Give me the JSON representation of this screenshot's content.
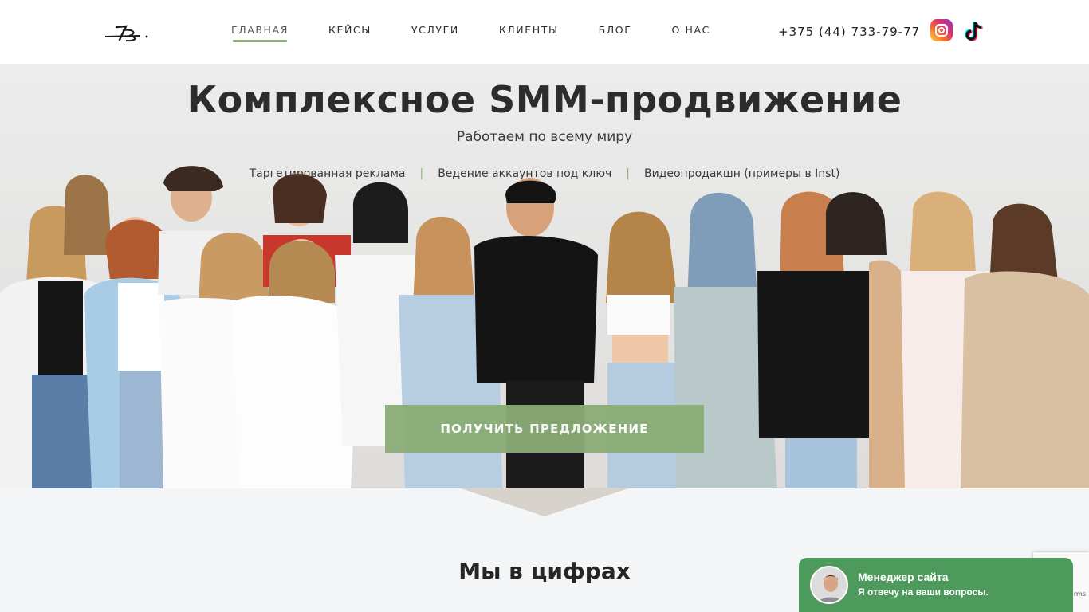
{
  "header": {
    "nav": [
      "ГЛАВНАЯ",
      "КЕЙСЫ",
      "УСЛУГИ",
      "КЛИЕНТЫ",
      "БЛОГ",
      "О НАС"
    ],
    "active_index": 0,
    "phone": "+375 (44) 733-79-77",
    "social_icons": [
      "instagram-icon",
      "tiktok-icon"
    ]
  },
  "hero": {
    "title": "Комплексное SMM-продвижение",
    "subtitle": "Работаем по всему миру",
    "services": [
      "Таргетированная реклама",
      "Ведение аккаунтов под ключ",
      "Видеопродакшн (примеры в Inst)"
    ],
    "cta": "ПОЛУЧИТЬ ПРЕДЛОЖЕНИЕ"
  },
  "stats": {
    "title": "Мы в цифрах"
  },
  "chat": {
    "name": "Менеджер сайта",
    "message": "Я отвечу на ваши вопросы."
  },
  "recaptcha": {
    "text": "rms"
  },
  "colors": {
    "accent": "#8aad76",
    "chat": "#4e9a5c",
    "text": "#2c2c2c"
  }
}
